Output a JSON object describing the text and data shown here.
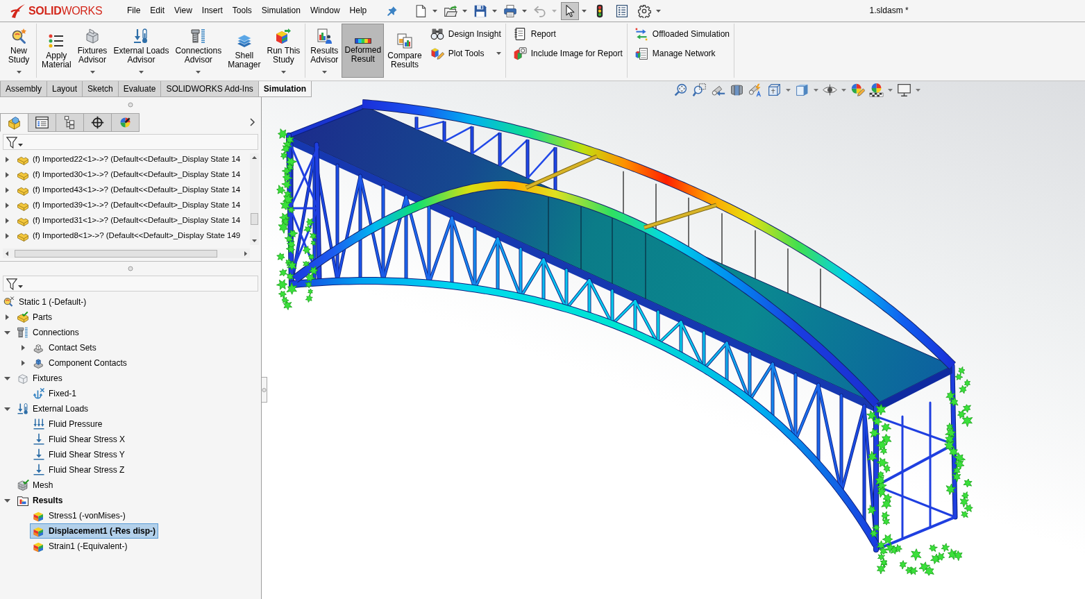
{
  "logo": "**SOLID**WORKS",
  "menu": [
    "File",
    "Edit",
    "View",
    "Insert",
    "Tools",
    "Simulation",
    "Window",
    "Help"
  ],
  "quick_access": [
    {
      "kind": "new",
      "dropdown": true,
      "disabled": false,
      "selected": false
    },
    {
      "kind": "open",
      "dropdown": true,
      "disabled": false,
      "selected": false
    },
    {
      "kind": "save",
      "dropdown": true,
      "disabled": false,
      "selected": false
    },
    {
      "kind": "print",
      "dropdown": true,
      "disabled": false,
      "selected": false
    },
    {
      "kind": "undo",
      "dropdown": true,
      "disabled": true,
      "selected": false
    },
    {
      "kind": "select",
      "dropdown": true,
      "disabled": false,
      "selected": true
    },
    {
      "kind": "rebuild",
      "disabled": false,
      "selected": false
    },
    {
      "kind": "file-properties",
      "disabled": false,
      "selected": false
    },
    {
      "kind": "options",
      "dropdown": true,
      "disabled": false,
      "selected": false
    }
  ],
  "document_title": "1.sldasm *",
  "ribbon": [
    {
      "large": [
        {
          "kind": "new-study",
          "label": "New\nStudy",
          "dropdown": true,
          "pressed": false
        }
      ]
    },
    {
      "large": [
        {
          "kind": "apply-material",
          "label": "Apply\nMaterial",
          "pressed": false
        },
        {
          "kind": "fixtures-advisor",
          "label": "Fixtures\nAdvisor",
          "dropdown": true,
          "pressed": false
        },
        {
          "kind": "external-loads-advisor",
          "label": "External Loads\nAdvisor",
          "dropdown": true,
          "pressed": false
        },
        {
          "kind": "connections-advisor",
          "label": "Connections\nAdvisor",
          "dropdown": true,
          "pressed": false
        },
        {
          "kind": "shell-manager",
          "label": "Shell\nManager",
          "pressed": false
        },
        {
          "kind": "run-study",
          "label": "Run This\nStudy",
          "dropdown": true,
          "pressed": false
        }
      ]
    },
    {
      "large": [
        {
          "kind": "results-advisor",
          "label": "Results\nAdvisor",
          "dropdown": true,
          "pressed": false
        },
        {
          "kind": "deformed-result",
          "label": "Deformed\nResult",
          "pressed": true
        },
        {
          "kind": "compare-results",
          "label": "Compare\nResults",
          "pressed": false
        }
      ],
      "small": [
        {
          "kind": "design-insight",
          "label": "Design Insight"
        },
        {
          "kind": "plot-tools",
          "label": "Plot Tools",
          "dropdown": true
        }
      ]
    },
    {
      "small": [
        {
          "kind": "report",
          "label": "Report"
        },
        {
          "kind": "include-image",
          "label": "Include Image for Report"
        }
      ]
    },
    {
      "small": [
        {
          "kind": "offloaded-simulation",
          "label": "Offloaded Simulation"
        },
        {
          "kind": "manage-network",
          "label": "Manage Network"
        }
      ]
    }
  ],
  "command_tabs": [
    {
      "label": "Assembly",
      "selected": false
    },
    {
      "label": "Layout",
      "selected": false
    },
    {
      "label": "Sketch",
      "selected": false
    },
    {
      "label": "Evaluate",
      "selected": false
    },
    {
      "label": "SOLIDWORKS Add-Ins",
      "selected": false
    },
    {
      "label": "Simulation",
      "selected": true
    }
  ],
  "feature_manager": {
    "tabs": [
      {
        "kind": "feature-tree",
        "selected": true
      },
      {
        "kind": "property",
        "selected": false
      },
      {
        "kind": "configuration",
        "selected": false
      },
      {
        "kind": "dimxpert",
        "selected": false
      },
      {
        "kind": "display",
        "selected": false
      }
    ],
    "rows": [
      {
        "label": "(f) Imported22<1>->? (Default<<Default>_Display State 14",
        "expanded": false,
        "selected": false
      },
      {
        "label": "(f) Imported30<1>->? (Default<<Default>_Display State 14",
        "expanded": false,
        "selected": false
      },
      {
        "label": "(f) Imported43<1>->? (Default<<Default>_Display State 14",
        "expanded": false,
        "selected": false
      },
      {
        "label": "(f) Imported39<1>->? (Default<<Default>_Display State 14",
        "expanded": false,
        "selected": false
      },
      {
        "label": "(f) Imported31<1>->? (Default<<Default>_Display State 14",
        "expanded": false,
        "selected": false
      },
      {
        "label": "(f) Imported8<1>->? (Default<<Default>_Display State 149",
        "expanded": false,
        "selected": false
      }
    ]
  },
  "simulation_tree": [
    {
      "label": "Static 1 (-Default-)",
      "kind": "study",
      "selected": false,
      "active": false,
      "children": [
        {
          "label": "Parts",
          "kind": "parts",
          "expanded": false,
          "selected": false,
          "active": false
        },
        {
          "label": "Connections",
          "kind": "connections",
          "expanded": true,
          "selected": false,
          "active": false,
          "children": [
            {
              "label": "Contact Sets",
              "kind": "contact-set",
              "expanded": false,
              "selected": false,
              "active": false
            },
            {
              "label": "Component Contacts",
              "kind": "component-contact",
              "expanded": false,
              "selected": false,
              "active": false
            }
          ]
        },
        {
          "label": "Fixtures",
          "kind": "fixtures",
          "expanded": true,
          "selected": false,
          "active": false,
          "children": [
            {
              "label": "Fixed-1",
              "kind": "fixed",
              "selected": false,
              "active": false
            }
          ]
        },
        {
          "label": "External Loads",
          "kind": "external-loads",
          "expanded": true,
          "selected": false,
          "active": false,
          "children": [
            {
              "label": "Fluid Pressure",
              "kind": "fluid-pressure",
              "selected": false,
              "active": false
            },
            {
              "label": "Fluid Shear Stress X",
              "kind": "shear-stress",
              "selected": false,
              "active": false
            },
            {
              "label": "Fluid Shear Stress Y",
              "kind": "shear-stress",
              "selected": false,
              "active": false
            },
            {
              "label": "Fluid Shear Stress Z",
              "kind": "shear-stress",
              "selected": false,
              "active": false
            }
          ]
        },
        {
          "label": "Mesh",
          "kind": "mesh",
          "selected": false,
          "active": false
        },
        {
          "label": "Results",
          "kind": "results",
          "expanded": true,
          "selected": false,
          "active": true,
          "children": [
            {
              "label": "Stress1 (-vonMises-)",
              "kind": "result-plot",
              "selected": false,
              "active": false
            },
            {
              "label": "Displacement1 (-Res disp-)",
              "kind": "result-plot",
              "selected": true,
              "active": true
            },
            {
              "label": "Strain1 (-Equivalent-)",
              "kind": "result-plot",
              "selected": false,
              "active": false
            }
          ]
        }
      ]
    }
  ],
  "view_toolbar": [
    {
      "kind": "zoom-to-fit"
    },
    {
      "kind": "zoom-to-area"
    },
    {
      "kind": "previous-view"
    },
    {
      "kind": "section-view"
    },
    {
      "kind": "dynamic-annotation"
    },
    {
      "kind": "view-orientation",
      "dropdown": true
    },
    {
      "kind": "display-style",
      "dropdown": true
    },
    {
      "kind": "hide-show",
      "dropdown": true
    },
    {
      "kind": "edit-appearance"
    },
    {
      "kind": "apply-scene",
      "dropdown": true
    },
    {
      "kind": "view-settings",
      "dropdown": true
    }
  ]
}
